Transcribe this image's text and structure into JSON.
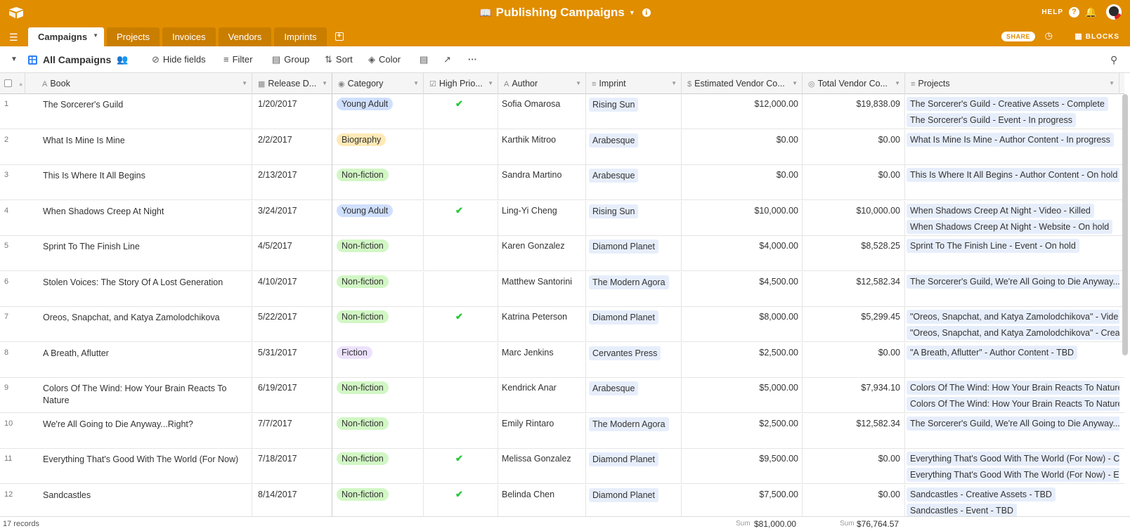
{
  "app": {
    "base_title": "Publishing Campaigns",
    "help_label": "HELP",
    "share_label": "SHARE",
    "blocks_label": "BLOCKS",
    "accent_color": "#e08d00",
    "icons": [
      "airtable-logo-icon",
      "book-icon",
      "chevron-down-icon",
      "info-icon",
      "help-icon",
      "bell-icon",
      "avatar",
      "menu-icon",
      "add-tab-icon",
      "history-icon",
      "blocks-icon"
    ]
  },
  "tabs": [
    {
      "label": "Campaigns",
      "active": true
    },
    {
      "label": "Projects",
      "active": false
    },
    {
      "label": "Invoices",
      "active": false
    },
    {
      "label": "Vendors",
      "active": false
    },
    {
      "label": "Imprints",
      "active": false
    }
  ],
  "viewbar": {
    "view_name": "All Campaigns",
    "hide_fields": "Hide fields",
    "filter": "Filter",
    "group": "Group",
    "sort": "Sort",
    "color": "Color"
  },
  "columns": [
    "Book",
    "Release D...",
    "Category",
    "High Prio...",
    "Author",
    "Imprint",
    "Estimated Vendor Co...",
    "Total Vendor Co...",
    "Projects"
  ],
  "category_colors": {
    "Young Adult": "#cfdfff",
    "Biography": "#ffeab6",
    "Non-fiction": "#d1f7c4",
    "Fiction": "#ede2fe"
  },
  "rows": [
    {
      "n": "1",
      "book": "The Sorcerer's Guild",
      "date": "1/20/2017",
      "category": "Young Adult",
      "high_priority": true,
      "author": "Sofia Omarosa",
      "imprint": "Rising Sun",
      "est": "$12,000.00",
      "total": "$19,838.09",
      "projects": [
        "The Sorcerer's Guild - Creative Assets - Complete",
        "The Sorcerer's Guild - Event - In progress"
      ]
    },
    {
      "n": "2",
      "book": "What Is Mine Is Mine",
      "date": "2/2/2017",
      "category": "Biography",
      "high_priority": false,
      "author": "Karthik Mitroo",
      "imprint": "Arabesque",
      "est": "$0.00",
      "total": "$0.00",
      "projects": [
        "What Is Mine Is Mine - Author Content - In progress"
      ]
    },
    {
      "n": "3",
      "book": "This Is Where It All Begins",
      "date": "2/13/2017",
      "category": "Non-fiction",
      "high_priority": false,
      "author": "Sandra Martino",
      "imprint": "Arabesque",
      "est": "$0.00",
      "total": "$0.00",
      "projects": [
        "This Is Where It All Begins - Author Content - On hold"
      ]
    },
    {
      "n": "4",
      "book": "When Shadows Creep At Night",
      "date": "3/24/2017",
      "category": "Young Adult",
      "high_priority": true,
      "author": "Ling-Yi Cheng",
      "imprint": "Rising Sun",
      "est": "$10,000.00",
      "total": "$10,000.00",
      "projects": [
        "When Shadows Creep At Night - Video - Killed",
        "When Shadows Creep At Night - Website - On hold"
      ]
    },
    {
      "n": "5",
      "book": "Sprint To The Finish Line",
      "date": "4/5/2017",
      "category": "Non-fiction",
      "high_priority": false,
      "author": "Karen Gonzalez",
      "imprint": "Diamond Planet",
      "est": "$4,000.00",
      "total": "$8,528.25",
      "projects": [
        "Sprint To The Finish Line - Event - On hold"
      ]
    },
    {
      "n": "6",
      "book": "Stolen Voices: The Story Of A Lost Generation",
      "date": "4/10/2017",
      "category": "Non-fiction",
      "high_priority": false,
      "author": "Matthew Santorini",
      "imprint": "The Modern Agora",
      "est": "$4,500.00",
      "total": "$12,582.34",
      "projects": [
        "The Sorcerer's Guild, We're All Going to Die Anyway..."
      ]
    },
    {
      "n": "7",
      "book": "Oreos, Snapchat, and Katya Zamolodchikova",
      "date": "5/22/2017",
      "category": "Non-fiction",
      "high_priority": true,
      "author": "Katrina Peterson",
      "imprint": "Diamond Planet",
      "est": "$8,000.00",
      "total": "$5,299.45",
      "projects": [
        "\"Oreos, Snapchat, and Katya Zamolodchikova\" - Vide",
        "\"Oreos, Snapchat, and Katya Zamolodchikova\" - Crea"
      ]
    },
    {
      "n": "8",
      "book": "A Breath, Aflutter",
      "date": "5/31/2017",
      "category": "Fiction",
      "high_priority": false,
      "author": "Marc Jenkins",
      "imprint": "Cervantes Press",
      "est": "$2,500.00",
      "total": "$0.00",
      "projects": [
        "\"A Breath, Aflutter\" - Author Content - TBD"
      ]
    },
    {
      "n": "9",
      "book": "Colors Of The Wind: How Your Brain Reacts To Nature",
      "date": "6/19/2017",
      "category": "Non-fiction",
      "high_priority": false,
      "author": "Kendrick Anar",
      "imprint": "Arabesque",
      "est": "$5,000.00",
      "total": "$7,934.10",
      "projects": [
        "Colors Of The Wind: How Your Brain Reacts To Nature",
        "Colors Of The Wind: How Your Brain Reacts To Nature"
      ]
    },
    {
      "n": "10",
      "book": "We're All Going to Die Anyway...Right?",
      "date": "7/7/2017",
      "category": "Non-fiction",
      "high_priority": false,
      "author": "Emily Rintaro",
      "imprint": "The Modern Agora",
      "est": "$2,500.00",
      "total": "$12,582.34",
      "projects": [
        "The Sorcerer's Guild, We're All Going to Die Anyway..."
      ]
    },
    {
      "n": "11",
      "book": "Everything That's Good With The World (For Now)",
      "date": "7/18/2017",
      "category": "Non-fiction",
      "high_priority": true,
      "author": "Melissa Gonzalez",
      "imprint": "Diamond Planet",
      "est": "$9,500.00",
      "total": "$0.00",
      "projects": [
        "Everything That's Good With The World (For Now) - C",
        "Everything That's Good With The World (For Now) - E"
      ]
    },
    {
      "n": "12",
      "book": "Sandcastles",
      "date": "8/14/2017",
      "category": "Non-fiction",
      "high_priority": true,
      "author": "Belinda Chen",
      "imprint": "Diamond Planet",
      "est": "$7,500.00",
      "total": "$0.00",
      "projects": [
        "Sandcastles - Creative Assets - TBD",
        "Sandcastles - Event - TBD"
      ]
    }
  ],
  "footer": {
    "records": "17 records",
    "sum_label": "Sum",
    "sum_est": "$81,000.00",
    "sum_total": "$76,764.57"
  }
}
